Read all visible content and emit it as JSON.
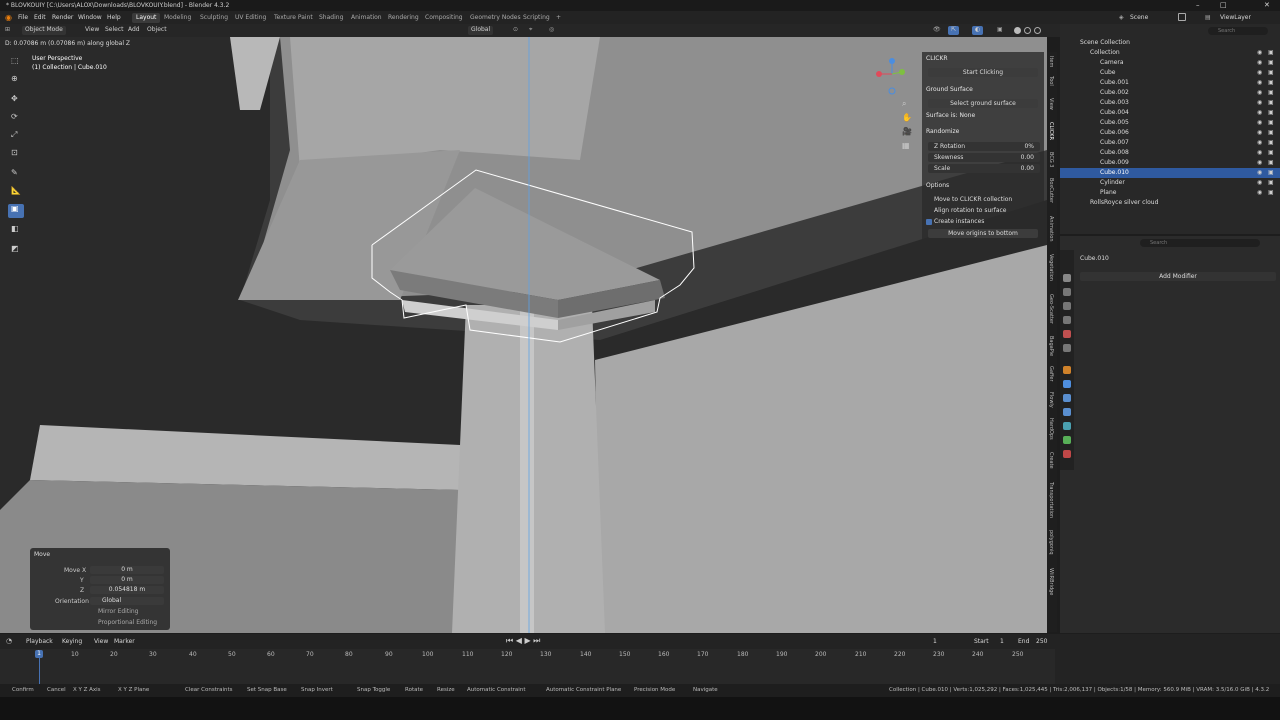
{
  "title_bar": {
    "title": "* BLOVKOUIY [C:\\Users\\ALOX\\Downloads\\BLOVKOUIY.blend] - Blender 4.3.2",
    "minimize": "–",
    "maximize": "□",
    "close": "✕"
  },
  "menu": {
    "items": [
      "File",
      "Edit",
      "Render",
      "Window",
      "Help"
    ]
  },
  "workspaces": {
    "tabs": [
      "Layout",
      "Modeling",
      "Sculpting",
      "UV Editing",
      "Texture Paint",
      "Shading",
      "Animation",
      "Rendering",
      "Compositing",
      "Geometry Nodes",
      "Scripting"
    ],
    "add": "+",
    "active": "Layout"
  },
  "scene": {
    "label": "Scene",
    "view_layer": "ViewLayer"
  },
  "viewport_header": {
    "mode": "Object Mode",
    "menus": [
      "View",
      "Select",
      "Add",
      "Object"
    ],
    "orientation": "Global"
  },
  "status_top": "D: 0.07086 m (0.07086 m) along global Z",
  "viewport_info": {
    "perspective": "User Perspective",
    "collection": "(1) Collection | Cube.010"
  },
  "npanel": {
    "addon": "CLICKR",
    "start_clicking": "Start Clicking",
    "ground_surface": "Ground Surface",
    "select_ground": "Select ground surface",
    "surface_is": "Surface is: None",
    "randomize": "Randomize",
    "rows": [
      {
        "label": "Z Rotation",
        "value": "0%"
      },
      {
        "label": "Skewness",
        "value": "0.00"
      },
      {
        "label": "Scale",
        "value": "0.00"
      }
    ],
    "options": "Options",
    "opt_items": [
      "Move to CLICKR collection",
      "Align rotation to surface",
      "Create instances",
      "Move origins to bottom"
    ]
  },
  "vertical_tabs": [
    "Item",
    "Tool",
    "View",
    "CLICKR",
    "BCG 3",
    "BoxCutter",
    "Animation",
    "Vegetation",
    "Geo-Scatter",
    "BagaPie",
    "Gaffer",
    "Flowly",
    "HardOps",
    "Create",
    "Transportation",
    "polygoniq",
    "WiiRBridge"
  ],
  "outliner": {
    "search_placeholder": "Search",
    "scene_collection": "Scene Collection",
    "collection": "Collection",
    "objects": [
      "Camera",
      "Cube",
      "Cube.001",
      "Cube.002",
      "Cube.003",
      "Cube.004",
      "Cube.005",
      "Cube.006",
      "Cube.007",
      "Cube.008",
      "Cube.009",
      "Cube.010",
      "Cylinder",
      "Plane"
    ],
    "selected": "Cube.010",
    "other": "RollsRoyce silver cloud"
  },
  "properties": {
    "search_placeholder": "Search",
    "object": "Cube.010",
    "add_modifier": "Add Modifier"
  },
  "move_panel": {
    "title": "Move",
    "rows": [
      {
        "label": "Move X",
        "value": "0 m"
      },
      {
        "label": "Y",
        "value": "0 m"
      },
      {
        "label": "Z",
        "value": "0.054818 m"
      }
    ],
    "orientation_label": "Orientation",
    "orientation_value": "Global",
    "mirror": "Mirror Editing",
    "proportional": "Proportional Editing"
  },
  "timeline": {
    "menus": [
      "Playback",
      "Keying",
      "View",
      "Marker"
    ],
    "current_frame": "1",
    "start_label": "Start",
    "start": "1",
    "end_label": "End",
    "end": "250",
    "ticks": [
      "1",
      "10",
      "20",
      "30",
      "40",
      "50",
      "60",
      "70",
      "80",
      "90",
      "100",
      "110",
      "120",
      "130",
      "140",
      "150",
      "160",
      "170",
      "180",
      "190",
      "200",
      "210",
      "220",
      "230",
      "240",
      "250"
    ]
  },
  "statusbar": {
    "left": [
      "Confirm",
      "Cancel",
      "X Y Z Axis",
      "X Y Z Plane",
      "Clear Constraints",
      "Set Snap Base",
      "Snap Invert",
      "Snap Toggle",
      "Rotate",
      "Resize",
      "Automatic Constraint",
      "Automatic Constraint Plane",
      "Precision Mode",
      "Navigate"
    ],
    "right": "Collection | Cube.010 | Verts:1,025,292 | Faces:1,025,445 | Tris:2,006,137 | Objects:1/58 | Memory: 560.9 MiB | VRAM: 3.5/16.0 GiB | 4.3.2"
  }
}
